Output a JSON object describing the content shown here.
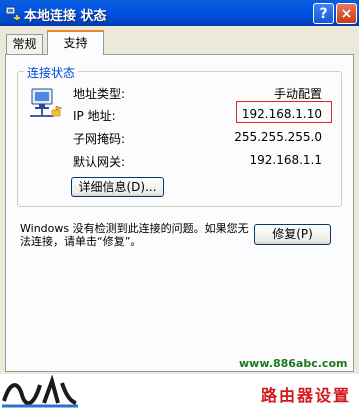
{
  "window": {
    "title": "本地连接 状态",
    "help_label": "?",
    "close_label": "×"
  },
  "tabs": [
    {
      "label": "常规"
    },
    {
      "label": "支持"
    }
  ],
  "connection_status": {
    "legend": "连接状态",
    "fields": [
      {
        "label": "地址类型:",
        "value": "手动配置"
      },
      {
        "label": "IP 地址:",
        "value": "192.168.1.10"
      },
      {
        "label": "子网掩码:",
        "value": "255.255.255.0"
      },
      {
        "label": "默认网关:",
        "value": "192.168.1.1"
      }
    ],
    "details_button": "详细信息(D)..."
  },
  "notice": "Windows 没有检测到此连接的问题。如果您无法连接，请单击“修复”。",
  "repair_button": "修复(P)",
  "watermark": {
    "url": "www.886abc.com",
    "caption": "路由器设置"
  },
  "colors": {
    "titlebar": "#0055e5",
    "highlight_border": "#e3251a",
    "group_legend": "#0046d5"
  }
}
